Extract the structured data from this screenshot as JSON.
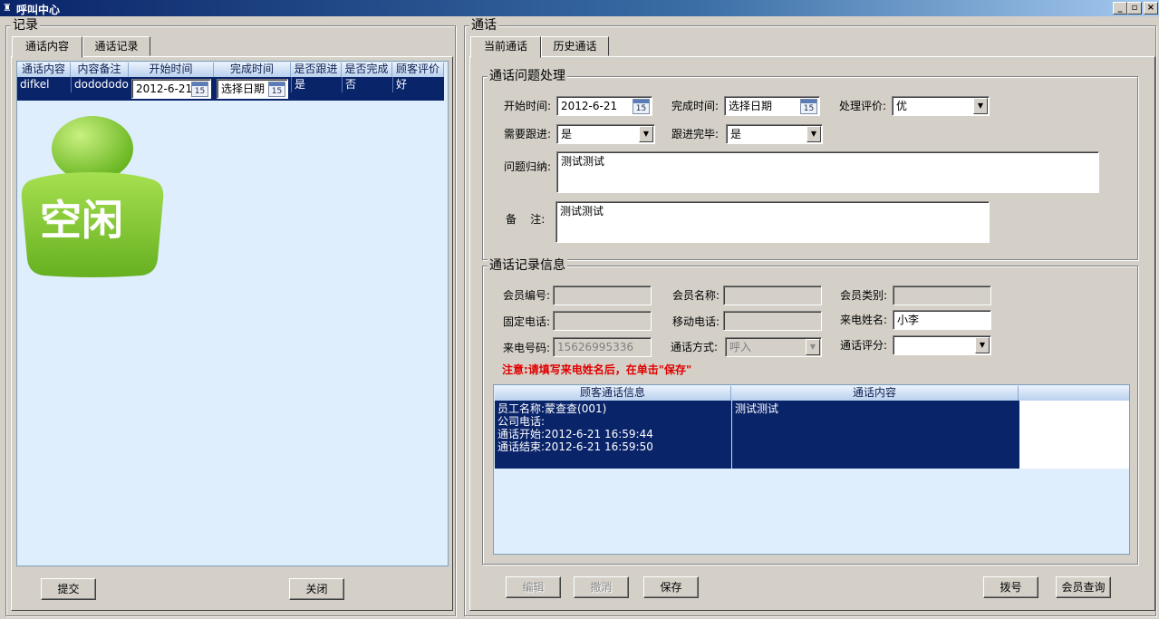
{
  "window": {
    "title": "呼叫中心",
    "min": "_",
    "restore": "▫",
    "close": "×"
  },
  "left": {
    "group_label": "记录",
    "tabs": [
      {
        "label": "通话内容"
      },
      {
        "label": "通话记录"
      }
    ],
    "grid": {
      "headers": [
        "通话内容",
        "内容备注",
        "开始时间",
        "完成时间",
        "是否跟进",
        "是否完成",
        "顾客评价"
      ],
      "row": {
        "content": "difkel",
        "note": "dododododo",
        "start": "2012-6-21",
        "end": "选择日期",
        "follow": "是",
        "done": "否",
        "rating": "好",
        "cal_day": "15"
      }
    },
    "status_badge": "空闲",
    "status_color": "#7cc42a",
    "buttons": {
      "submit": "提交",
      "close": "关闭"
    }
  },
  "right": {
    "group_label": "通话",
    "tabs": [
      {
        "label": "当前通话"
      },
      {
        "label": "历史通话"
      }
    ],
    "issue": {
      "group_label": "通话问题处理",
      "start_label": "开始时间:",
      "start_value": "2012-6-21",
      "end_label": "完成时间:",
      "end_value": "选择日期",
      "eval_label": "处理评价:",
      "eval_value": "优",
      "follow_label": "需要跟进:",
      "follow_value": "是",
      "follow_done_label": "跟进完毕:",
      "follow_done_value": "是",
      "summary_label": "问题归纳:",
      "summary_value": "测试测试",
      "remark_label": "备    注:",
      "remark_value": "测试测试",
      "cal_day": "15"
    },
    "record": {
      "group_label": "通话记录信息",
      "member_no_label": "会员编号:",
      "member_no": "",
      "member_name_label": "会员名称:",
      "member_name": "",
      "member_type_label": "会员类别:",
      "member_type": "",
      "phone_label": "固定电话:",
      "phone": "",
      "mobile_label": "移动电话:",
      "mobile": "",
      "caller_name_label": "来电姓名:",
      "caller_name": "小李",
      "caller_no_label": "来电号码:",
      "caller_no": "15626995336",
      "call_type_label": "通话方式:",
      "call_type": "呼入",
      "call_score_label": "通话评分:",
      "call_score": "",
      "notice": "注意:请填写来电姓名后，在单击\"保存\"",
      "grid": {
        "headers": [
          "顾客通话信息",
          "通话内容"
        ],
        "info_lines": [
          "员工名称:蒙查查(001)",
          "公司电话:",
          "通话开始:2012-6-21 16:59:44",
          "通话结束:2012-6-21 16:59:50"
        ],
        "content": "测试测试"
      }
    },
    "buttons": {
      "edit": "编辑",
      "undo": "撤消",
      "save": "保存",
      "dial": "拨号",
      "member_query": "会员查询"
    }
  }
}
